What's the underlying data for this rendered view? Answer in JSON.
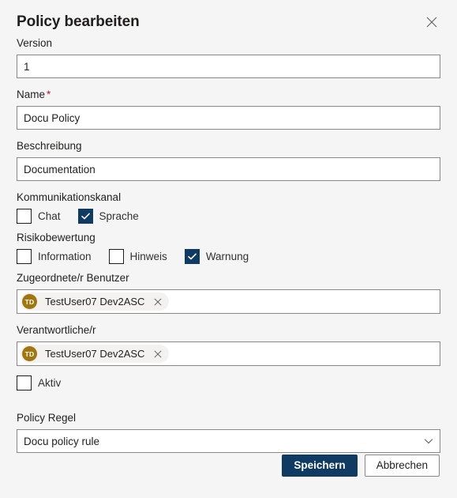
{
  "dialog": {
    "title": "Policy bearbeiten",
    "close_icon": "close-icon"
  },
  "fields": {
    "version": {
      "label": "Version",
      "value": "1"
    },
    "name": {
      "label": "Name",
      "required_marker": "*",
      "value": "Docu Policy"
    },
    "description": {
      "label": "Beschreibung",
      "value": "Documentation"
    },
    "communication_channel": {
      "label": "Kommunikationskanal",
      "options": [
        {
          "label": "Chat",
          "checked": false
        },
        {
          "label": "Sprache",
          "checked": true
        }
      ]
    },
    "risk_assessment": {
      "label": "Risikobewertung",
      "options": [
        {
          "label": "Information",
          "checked": false
        },
        {
          "label": "Hinweis",
          "checked": false
        },
        {
          "label": "Warnung",
          "checked": true
        }
      ]
    },
    "assigned_user": {
      "label": "Zugeordnete/r Benutzer",
      "person": {
        "initials": "TD",
        "name": "TestUser07 Dev2ASC"
      }
    },
    "responsible": {
      "label": "Verantwortliche/r",
      "person": {
        "initials": "TD",
        "name": "TestUser07 Dev2ASC"
      }
    },
    "active": {
      "label": "Aktiv",
      "checked": false
    },
    "policy_rule": {
      "label": "Policy Regel",
      "value": "Docu policy rule"
    }
  },
  "footer": {
    "save_label": "Speichern",
    "cancel_label": "Abbrechen"
  },
  "colors": {
    "accent": "#0f3b63",
    "required": "#a4262c",
    "avatar": "#a1760c",
    "background": "#f5f5f5",
    "border": "#8a8886"
  }
}
